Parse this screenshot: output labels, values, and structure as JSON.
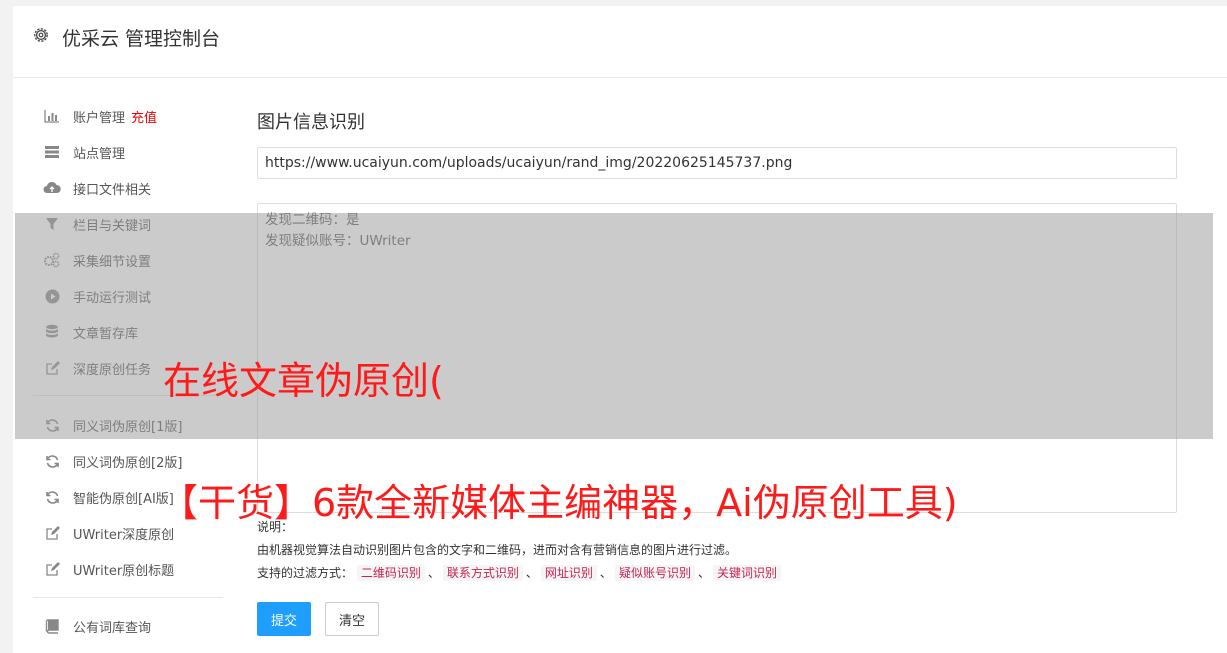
{
  "header": {
    "title": "优采云 管理控制台",
    "icon": "gear-icon"
  },
  "sidebar": {
    "items": [
      {
        "label": "账户管理",
        "highlight": "充值",
        "icon": "bar-chart-icon"
      },
      {
        "label": "站点管理",
        "icon": "server-icon"
      },
      {
        "label": "接口文件相关",
        "icon": "cloud-upload-icon"
      },
      {
        "label": "栏目与关键词",
        "icon": "filter-icon"
      },
      {
        "label": "采集细节设置",
        "icon": "gears-icon"
      },
      {
        "label": "手动运行测试",
        "icon": "play-icon"
      },
      {
        "label": "文章暂存库",
        "icon": "database-icon"
      },
      {
        "label": "深度原创任务",
        "icon": "edit-icon"
      },
      {
        "label": "同义词伪原创[1版]",
        "icon": "refresh-icon"
      },
      {
        "label": "同义词伪原创[2版]",
        "icon": "refresh-icon"
      },
      {
        "label": "智能伪原创[AI版]",
        "icon": "refresh-icon"
      },
      {
        "label": "UWriter深度原创",
        "icon": "edit-icon"
      },
      {
        "label": "UWriter原创标题",
        "icon": "edit-icon"
      },
      {
        "label": "公有词库查询",
        "icon": "book-icon"
      }
    ]
  },
  "main": {
    "title": "图片信息识别",
    "url_value": "https://www.ucaiyun.com/uploads/ucaiyun/rand_img/20220625145737.png",
    "result_lines": [
      "发现二维码：是",
      "发现疑似账号：UWriter"
    ],
    "notes_label": "说明：",
    "notes_desc": "由机器视觉算法自动识别图片包含的文字和二维码，进而对含有营销信息的图片进行过滤。",
    "filter_label": "支持的过滤方式：",
    "filter_tags": [
      "二维码识别",
      "联系方式识别",
      "网址识别",
      "疑似账号识别",
      "关键词识别"
    ],
    "filter_sep": "、",
    "submit_label": "提交",
    "clear_label": "清空"
  },
  "overlay": {
    "line1": "在线文章伪原创(",
    "line2": "【干货】6款全新媒体主编神器，Ai伪原创工具)",
    "text_color": "#ff1a1a"
  }
}
